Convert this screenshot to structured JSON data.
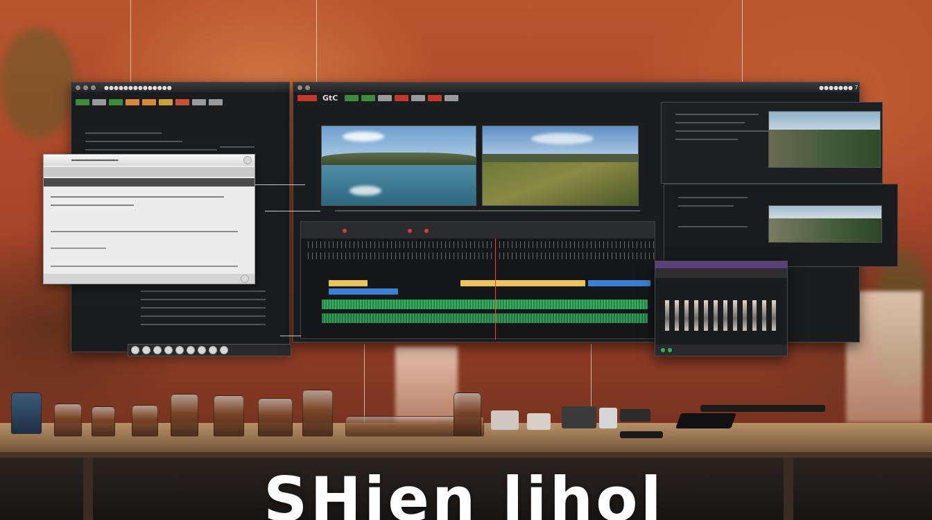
{
  "brand": {
    "text": "SHien lihol"
  },
  "editor": {
    "main_window": {
      "toolbar_label": "GtC",
      "status_label": "●●●●●●● 7"
    },
    "left_window": {
      "toolbar_label": "●●●●●●●●●●●●●●"
    },
    "floating_dialog": {
      "header": "▬▬▬▬▬▬▬▬▬▬▬▬▬▬▬▬",
      "buttons": [
        "",
        "",
        "",
        ""
      ]
    },
    "viewers": {
      "left_preview": "lake-landscape",
      "right_preview": "grass-hills-landscape"
    },
    "timeline": {
      "tracks": [
        "video-track-1",
        "audio-track-1",
        "audio-track-2"
      ]
    }
  },
  "colors": {
    "wall": "#a9462a",
    "panel_bg": "#1b1c1e",
    "clip_yellow": "#e8c55a",
    "clip_blue": "#3c7fd0",
    "audio_green": "#2f9a55",
    "record_red": "#d9383b"
  }
}
